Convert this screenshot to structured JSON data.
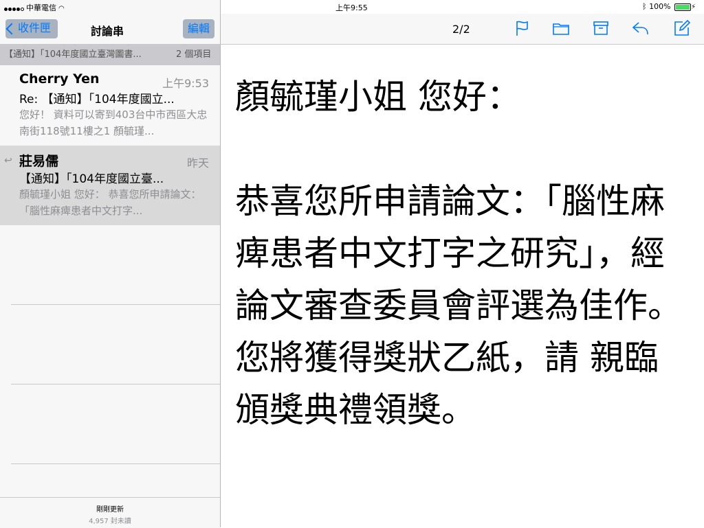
{
  "status_bar": {
    "carrier": "中華電信",
    "time": "上午9:55",
    "battery": "100%",
    "battery_level": 1.0
  },
  "list_nav": {
    "back_label": "收件匣",
    "title": "討論串",
    "edit_label": "編輯"
  },
  "thread": {
    "subject": "【通知】「104年度國立臺灣圖書...",
    "count": "2 個項目"
  },
  "messages": [
    {
      "sender": "Cherry Yen",
      "time": "上午9:53",
      "subject": "Re: 【通知】「104年度國立...",
      "preview": "您好！ 資料可以寄到403台中市西區大忠南街118號11樓之1 顏毓瑾..."
    },
    {
      "sender": "莊易儒",
      "time": "昨天",
      "subject": "【通知】「104年度國立臺...",
      "preview": "顏毓瑾小姐 您好： 恭喜您所申請論文：「腦性麻痺患者中文打字..."
    }
  ],
  "list_footer": {
    "updated": "剛剛更新",
    "unread": "4,957 封未讀"
  },
  "detail_nav": {
    "counter": "2/2",
    "icons": [
      "flag-icon",
      "folder-icon",
      "archive-icon",
      "reply-icon",
      "compose-icon"
    ],
    "accent": "#007aff"
  },
  "body": {
    "greeting": "顏毓瑾小姐 您好：",
    "para1": "恭喜您所申請論文：「腦性麻痺患者中文打字之研究」，經論文審查委員會評選為佳作。",
    "para2": "您將獲得獎狀乙紙，請 親臨頒獎典禮領獎。"
  }
}
